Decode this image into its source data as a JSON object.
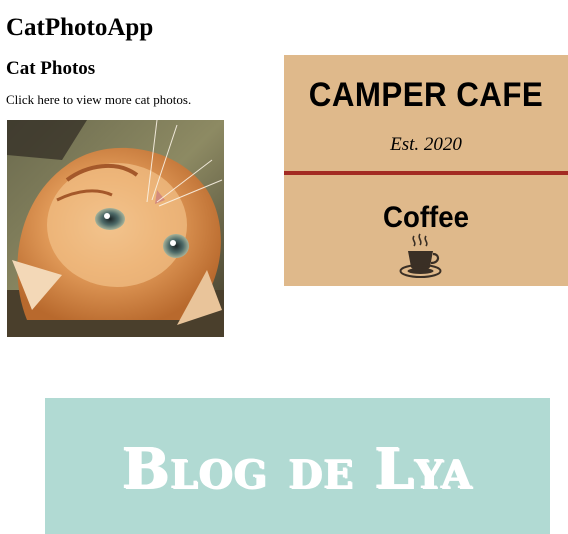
{
  "app": {
    "title": "CatPhotoApp"
  },
  "cat_section": {
    "heading": "Cat Photos",
    "intro": "Click here to view more cat photos.",
    "photo_label": "A cute orange cat lying on its back."
  },
  "cafe": {
    "name": "CAMPER CAFE",
    "established": "Est. 2020",
    "menu_heading": "Coffee",
    "background_color": "#dfb98b",
    "divider_color": "#a32b23",
    "icon": "coffee-cup-icon"
  },
  "blog": {
    "title": "Blog de Lya",
    "background_color": "#b1dad3",
    "text_color": "#ffffff"
  }
}
